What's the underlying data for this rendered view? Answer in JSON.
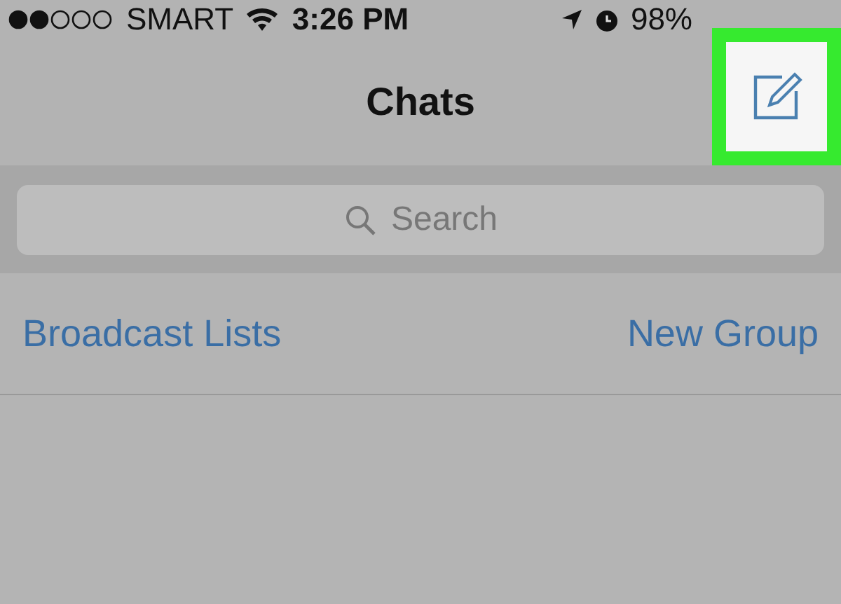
{
  "status_bar": {
    "carrier": "SMART",
    "time": "3:26 PM",
    "battery": "98%"
  },
  "nav": {
    "title": "Chats",
    "compose": {
      "highlighted": true
    }
  },
  "search": {
    "placeholder": "Search"
  },
  "links": [
    "Broadcast Lists",
    "New Group"
  ]
}
